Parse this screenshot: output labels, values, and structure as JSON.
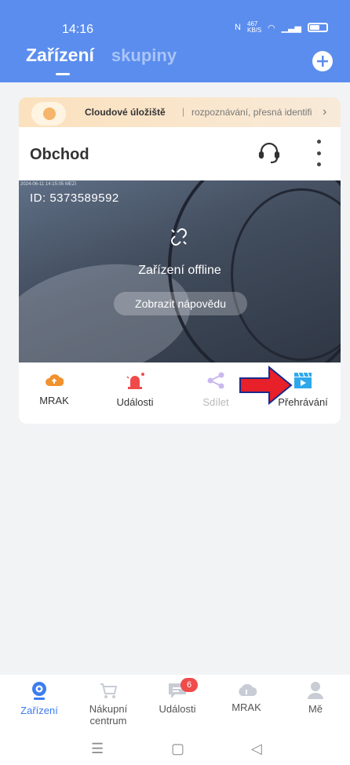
{
  "status_bar": {
    "time": "14:16",
    "network_speed": "467 KB/S"
  },
  "header": {
    "tabs": [
      "Zařízení",
      "skupiny"
    ],
    "active_tab": "Zařízení",
    "add_icon": "plus-circle-icon"
  },
  "cloud_banner": {
    "title": "Cloudové úložiště",
    "separator": "|",
    "subtitle": "rozpoznávání, přesná identifi",
    "chevron": "›"
  },
  "device": {
    "name": "Obchod",
    "id_label": "ID:  5373589592",
    "stamp": "2024-06-11 14:15:05 MEZI",
    "offline_text": "Zařízení offline",
    "help_button": "Zobrazit nápovědu",
    "actions": [
      {
        "label": "MRAK",
        "icon": "cloud-upload-icon",
        "color": "#f0922e"
      },
      {
        "label": "Události",
        "icon": "alarm-siren-icon",
        "color": "#f04b4b"
      },
      {
        "label": "Sdílet",
        "icon": "share-icon",
        "color": "#c8b9ef",
        "disabled": true
      },
      {
        "label": "Přehrávání",
        "icon": "playback-icon",
        "color": "#2ea8ea"
      }
    ]
  },
  "bottom_nav": [
    {
      "label": "Zařízení",
      "icon": "camera-icon",
      "active": true
    },
    {
      "label": "Nákupní centrum",
      "icon": "cart-icon"
    },
    {
      "label": "Události",
      "icon": "message-icon",
      "badge": "6"
    },
    {
      "label": "MRAK",
      "icon": "cloud-icon"
    },
    {
      "label": "Mě",
      "icon": "person-icon"
    }
  ],
  "system_nav": {
    "menu": "☰",
    "home": "▢",
    "back": "◁"
  }
}
